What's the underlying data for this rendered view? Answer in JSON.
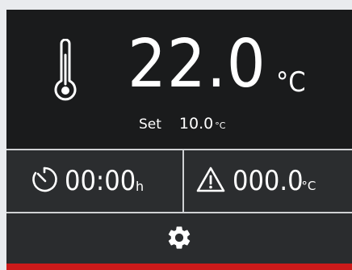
{
  "display": {
    "current_temperature": "22.0",
    "temperature_unit": "°C",
    "setpoint_label": "Set",
    "setpoint_value": "10.0",
    "setpoint_unit": "°C"
  },
  "timer": {
    "icon": "timer-icon",
    "value": "00:00",
    "unit": "h"
  },
  "alarm": {
    "icon": "warning-icon",
    "value": "000.0",
    "unit": "°C"
  },
  "settings": {
    "icon": "gear-icon"
  },
  "colors": {
    "background": "#e9ebee",
    "panel": "#1a1b1c",
    "secondary_panel": "#2b2d2f",
    "divider": "#cfd1d3",
    "text": "#ffffff",
    "accent": "#cc1a1a"
  }
}
